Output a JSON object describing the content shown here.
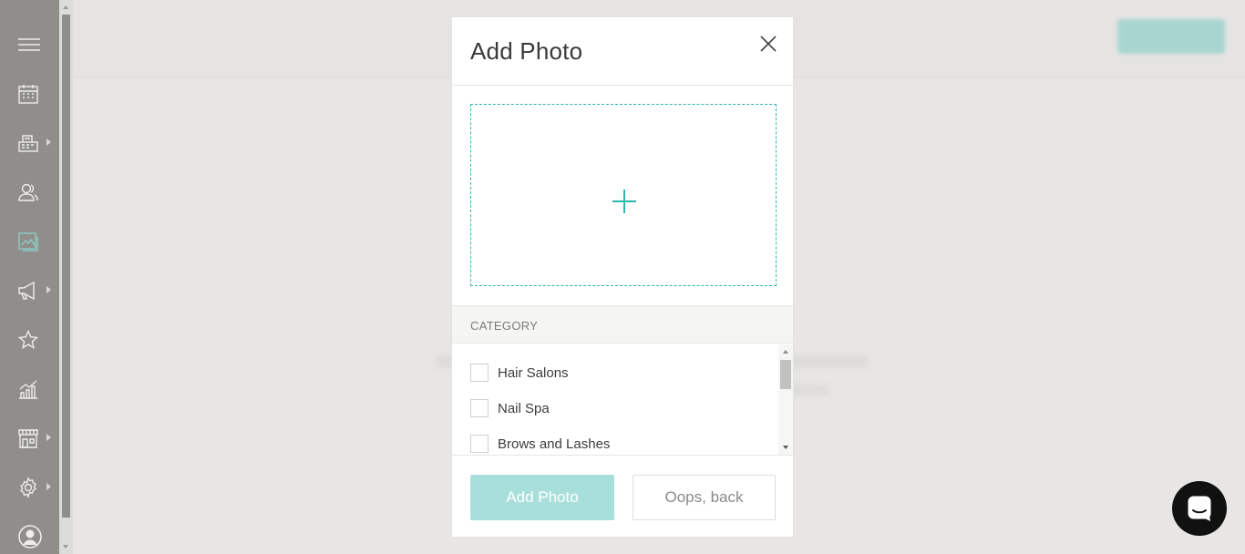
{
  "modal": {
    "title": "Add Photo",
    "category_heading": "CATEGORY",
    "categories": [
      {
        "label": "Hair Salons",
        "checked": false
      },
      {
        "label": "Nail Spa",
        "checked": false
      },
      {
        "label": "Brows and Lashes",
        "checked": false
      }
    ],
    "add_button": "Add Photo",
    "back_button": "Oops, back"
  },
  "sidebar": {
    "items": [
      {
        "icon": "menu-icon"
      },
      {
        "icon": "calendar-icon"
      },
      {
        "icon": "register-icon",
        "has_submenu": true
      },
      {
        "icon": "clients-icon"
      },
      {
        "icon": "photos-icon",
        "active": true
      },
      {
        "icon": "marketing-icon",
        "has_submenu": true
      },
      {
        "icon": "reviews-star-icon"
      },
      {
        "icon": "reports-icon"
      },
      {
        "icon": "store-icon",
        "has_submenu": true
      },
      {
        "icon": "settings-gear-icon",
        "has_submenu": true
      },
      {
        "icon": "profile-avatar-icon"
      }
    ]
  },
  "colors": {
    "accent": "#2bb7ad",
    "sidebar_bg": "#8f8e8b",
    "primary_disabled": "#a9dfdb"
  }
}
